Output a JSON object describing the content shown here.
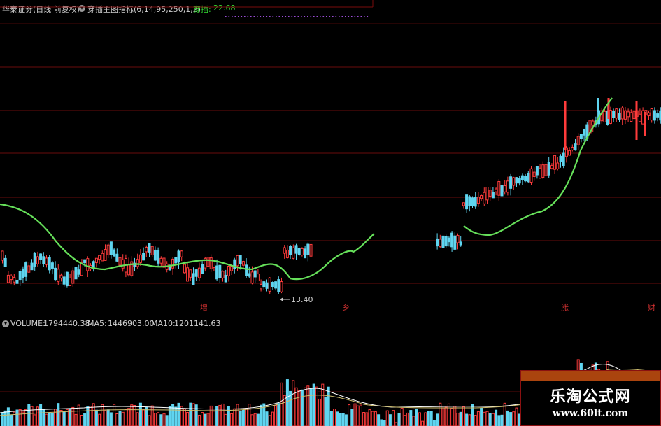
{
  "header": {
    "stock_title": "华泰证券(日线 前复权)",
    "indicator_label": "穿插主图指标(6,14,95,250,1,2)",
    "indicator_value_label": "穿插:",
    "indicator_value": "22.68",
    "toggle_icon": "chevron-circle-icon"
  },
  "annotations": {
    "low_price": "13.40",
    "marker_1": "增",
    "marker_2": "乡",
    "marker_3": "涨",
    "marker_4": "财"
  },
  "volume": {
    "label": "VOLUME:",
    "value": "1794440.38",
    "ma5_label": "MA5:",
    "ma5_value": "1446903.00",
    "ma10_label": "MA10:",
    "ma10_value": "1201141.63"
  },
  "watermark": {
    "title": "乐淘公式网",
    "url": "www.60lt.com"
  },
  "colors": {
    "up": "#ff3b3b",
    "down": "#5fd5f0",
    "ma_line": "#66e05a",
    "grid": "#6a0c0c",
    "purple_dots": "#9a4dd6"
  }
}
